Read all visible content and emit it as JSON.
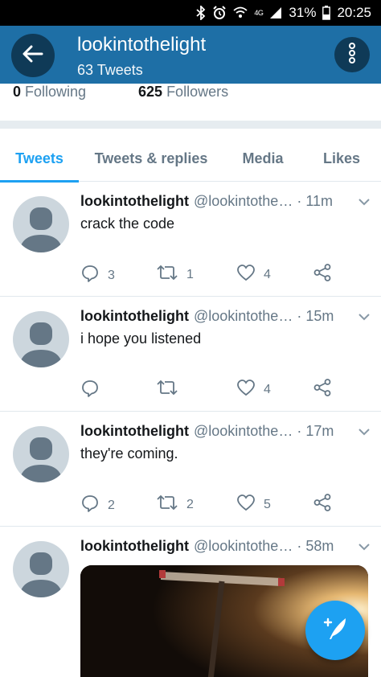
{
  "status_bar": {
    "battery": "31%",
    "time": "20:25",
    "network": "4G"
  },
  "header": {
    "name": "lookintothelight",
    "tweet_count": "63 Tweets"
  },
  "stats": {
    "following_count": "0",
    "following_label": "Following",
    "followers_count": "625",
    "followers_label": "Followers"
  },
  "tabs": [
    {
      "label": "Tweets",
      "active": true
    },
    {
      "label": "Tweets & replies",
      "active": false
    },
    {
      "label": "Media",
      "active": false
    },
    {
      "label": "Likes",
      "active": false
    }
  ],
  "tweets": [
    {
      "name": "lookintothelight",
      "handle": "@lookintothe…",
      "time": "11m",
      "text": "crack the code",
      "replies": "3",
      "retweets": "1",
      "likes": "4"
    },
    {
      "name": "lookintothelight",
      "handle": "@lookintothe…",
      "time": "15m",
      "text": "i hope you listened",
      "replies": "",
      "retweets": "",
      "likes": "4"
    },
    {
      "name": "lookintothelight",
      "handle": "@lookintothe…",
      "time": "17m",
      "text": "they're coming.",
      "replies": "2",
      "retweets": "2",
      "likes": "5"
    },
    {
      "name": "lookintothelight",
      "handle": "@lookintothe…",
      "time": "58m",
      "text": "",
      "has_media": true
    }
  ],
  "colors": {
    "appbar": "#1e6fa6",
    "accent": "#1da1f2",
    "muted": "#657786"
  },
  "icons": {
    "back": "arrow-left-icon",
    "more": "more-vertical-icon",
    "compose": "compose-tweet-icon"
  }
}
